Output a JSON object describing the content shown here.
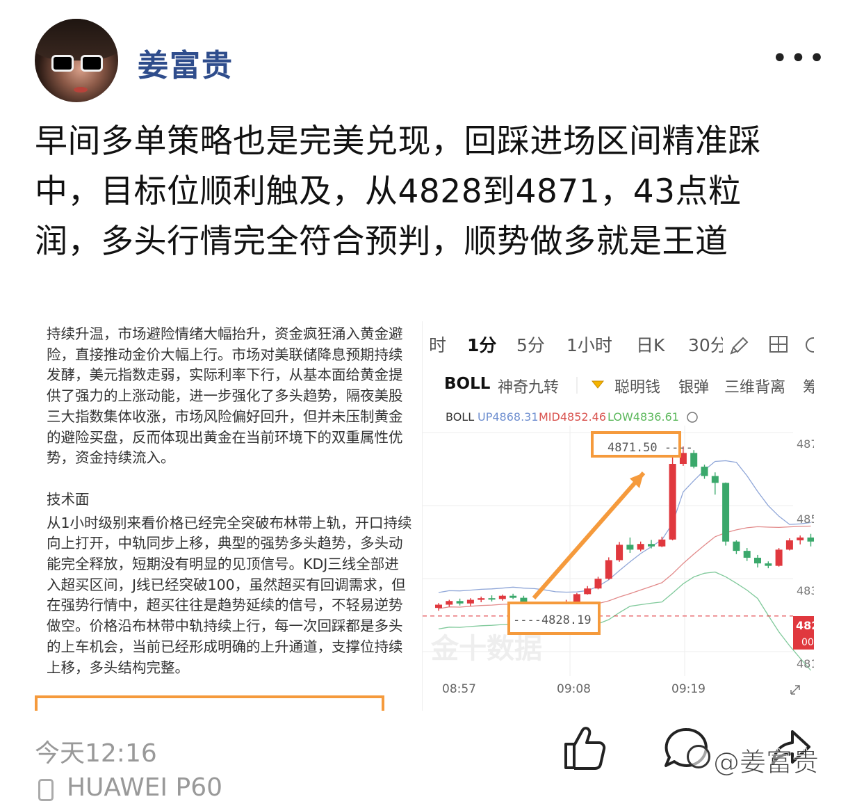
{
  "author": {
    "name": "姜富贵"
  },
  "post": {
    "text": "早间多单策略也是完美兑现，回踩进场区间精准踩中，目标位顺利触及，从4828到4871，43点粒润，多头行情完全符合预判，顺势做多就是王道"
  },
  "image_left": {
    "para1": "持续升温，市场避险情绪大幅抬升，资金疯狂涌入黄金避险，直接推动金价大幅上行。市场对美联储降息预期持续发酵，美元指数走弱，实际利率下行，从基本面给黄金提供了强力的上涨动能，进一步强化了多头趋势，隔夜美股三大指数集体收涨，市场风险偏好回升，但并未压制黄金的避险买盘，反而体现出黄金在当前环境下的双重属性优势，资金持续流入。",
    "heading": "技术面",
    "para2": "从1小时级别来看价格已经完全突破布林带上轨，开口持续向上打开，中轨同步上移，典型的强势多头趋势，多头动能完全释放，短期没有明显的见顶信号。KDJ三线全部进入超买区间，J线已经突破100，虽然超买有回调需求，但在强势行情中，超买往往是趋势延续的信号，不轻易逆势做空。价格沿布林带中轨持续上行，每一次回踩都是多头的上车机会，当前已经形成明确的上升通道，支撑位持续上移，多头结构完整。"
  },
  "image_right": {
    "tabs": [
      "时",
      "1分",
      "5分",
      "1小时",
      "日K",
      "30分"
    ],
    "indicators": [
      "BOLL",
      "神奇九转",
      "聪明钱",
      "银弹",
      "三维背离",
      "筹"
    ],
    "boll": {
      "label": "BOLL",
      "up": "UP4868.31",
      "mid": "MID4852.46",
      "low": "LOW4836.61"
    },
    "price_labels": {
      "high": "4871.50",
      "low": "4828.19"
    },
    "axis_right": [
      "487",
      "485",
      "483",
      "482",
      "00",
      "481"
    ],
    "times": [
      "08:57",
      "09:08",
      "09:19"
    ],
    "watermark": "金十数据"
  },
  "chart_data": {
    "type": "candlestick",
    "title": "",
    "x_labels": [
      "08:57",
      "09:08",
      "09:19"
    ],
    "y_ticks": [
      "487",
      "485",
      "483",
      "481"
    ],
    "series": [
      {
        "name": "BOLL UP",
        "value": 4868.31
      },
      {
        "name": "BOLL MID",
        "value": 4852.46
      },
      {
        "name": "BOLL LOW",
        "value": 4836.61
      }
    ],
    "annotations": [
      "4871.50",
      "4828.19"
    ],
    "candles": [
      [
        4831.6,
        4832.8,
        4830.9,
        4832.4
      ],
      [
        4832.4,
        4833.6,
        4831.9,
        4833.3
      ],
      [
        4833.3,
        4833.9,
        4832.2,
        4832.7
      ],
      [
        4832.7,
        4834.0,
        4832.1,
        4833.6
      ],
      [
        4833.6,
        4834.4,
        4833.0,
        4834.0
      ],
      [
        4834.0,
        4834.7,
        4833.2,
        4833.8
      ],
      [
        4833.8,
        4834.9,
        4833.4,
        4834.6
      ],
      [
        4834.6,
        4835.1,
        4833.8,
        4834.1
      ],
      [
        4834.1,
        4834.6,
        4831.0,
        4831.6
      ],
      [
        4831.6,
        4832.4,
        4830.6,
        4831.9
      ],
      [
        4831.9,
        4832.3,
        4830.9,
        4831.3
      ],
      [
        4831.3,
        4832.2,
        4828.2,
        4830.9
      ],
      [
        4830.9,
        4833.6,
        4830.7,
        4833.1
      ],
      [
        4833.1,
        4835.3,
        4832.9,
        4835.0
      ],
      [
        4835.0,
        4837.0,
        4834.9,
        4836.4
      ],
      [
        4836.4,
        4839.3,
        4836.2,
        4838.8
      ],
      [
        4838.8,
        4844.1,
        4838.6,
        4843.4
      ],
      [
        4843.4,
        4847.9,
        4843.0,
        4847.2
      ],
      [
        4847.2,
        4849.0,
        4845.2,
        4846.0
      ],
      [
        4846.0,
        4848.0,
        4845.6,
        4847.4
      ],
      [
        4847.4,
        4848.4,
        4846.3,
        4846.8
      ],
      [
        4846.8,
        4849.2,
        4846.6,
        4848.5
      ],
      [
        4848.5,
        4868.8,
        4848.3,
        4867.2
      ],
      [
        4867.2,
        4871.5,
        4866.7,
        4869.9
      ],
      [
        4869.9,
        4870.6,
        4866.1,
        4866.5
      ],
      [
        4866.5,
        4867.0,
        4863.5,
        4864.2
      ],
      [
        4864.2,
        4865.1,
        4859.6,
        4862.5
      ],
      [
        4862.5,
        4862.6,
        4847.0,
        4848.0
      ],
      [
        4848.0,
        4848.3,
        4844.9,
        4845.7
      ],
      [
        4845.7,
        4846.4,
        4843.2,
        4844.0
      ],
      [
        4844.0,
        4844.7,
        4841.6,
        4842.6
      ],
      [
        4842.6,
        4843.1,
        4841.4,
        4842.0
      ],
      [
        4842.0,
        4846.4,
        4841.8,
        4846.0
      ],
      [
        4846.0,
        4848.8,
        4845.8,
        4848.3
      ],
      [
        4848.3,
        4849.5,
        4847.3,
        4849.0
      ],
      [
        4849.0,
        4849.9,
        4846.8,
        4848.0
      ]
    ]
  },
  "footer": {
    "time": "今天12:16",
    "device": "HUAWEI P60",
    "watermark": "@姜富贵"
  },
  "colors": {
    "author": "#2f4d8c",
    "orange": "#f59a3c",
    "up": "#e0383e",
    "down": "#3aa86b"
  }
}
